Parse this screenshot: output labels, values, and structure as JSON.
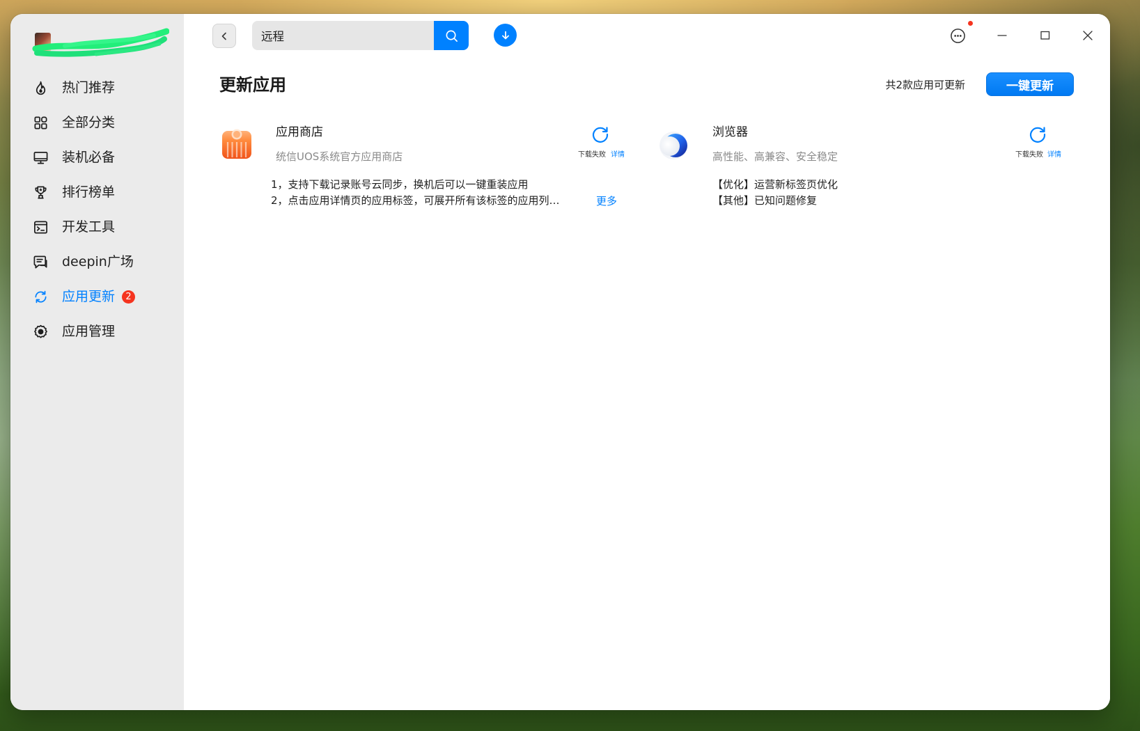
{
  "colors": {
    "accent": "#0081ff",
    "badge": "#f5341f",
    "sidebar_bg": "#ebebeb",
    "text": "#1f1f1f",
    "muted": "#8a8a8a"
  },
  "account": {
    "avatar_icon": "user-avatar"
  },
  "sidebar": {
    "items": [
      {
        "label": "热门推荐",
        "icon": "fire-icon",
        "active": false
      },
      {
        "label": "全部分类",
        "icon": "grid-icon",
        "active": false
      },
      {
        "label": "装机必备",
        "icon": "monitor-icon",
        "active": false
      },
      {
        "label": "排行榜单",
        "icon": "trophy-icon",
        "active": false
      },
      {
        "label": "开发工具",
        "icon": "terminal-icon",
        "active": false
      },
      {
        "label": "deepin广场",
        "icon": "chat-icon",
        "active": false
      },
      {
        "label": "应用更新",
        "icon": "refresh-icon",
        "active": true,
        "badge": "2"
      },
      {
        "label": "应用管理",
        "icon": "gear-icon",
        "active": false
      }
    ]
  },
  "toolbar": {
    "back_icon": "chevron-left-icon",
    "search": {
      "value": "远程",
      "icon": "search-icon"
    },
    "download_icon": "download-icon"
  },
  "window_controls": {
    "menu_icon": "more-icon",
    "has_notification": true,
    "minimize_icon": "minimize-icon",
    "maximize_icon": "maximize-icon",
    "close_icon": "close-icon"
  },
  "main": {
    "title": "更新应用",
    "summary": "共2款应用可更新",
    "update_all_label": "一键更新",
    "apps": [
      {
        "name": "应用商店",
        "icon": "app-store-icon",
        "subtitle": "统信UOS系统官方应用商店",
        "action_icon": "refresh-icon",
        "status": "下载失败",
        "detail_label": "详情",
        "notes": [
          "1，支持下载记录账号云同步，换机后可以一键重装应用",
          "2，点击应用详情页的应用标签，可展开所有该标签的应用列…"
        ],
        "more_label": "更多"
      },
      {
        "name": "浏览器",
        "icon": "browser-icon",
        "subtitle": "高性能、高兼容、安全稳定",
        "action_icon": "refresh-icon",
        "status": "下载失败",
        "detail_label": "详情",
        "notes": [
          "【优化】运营新标签页优化",
          "【其他】已知问题修复"
        ]
      }
    ]
  }
}
